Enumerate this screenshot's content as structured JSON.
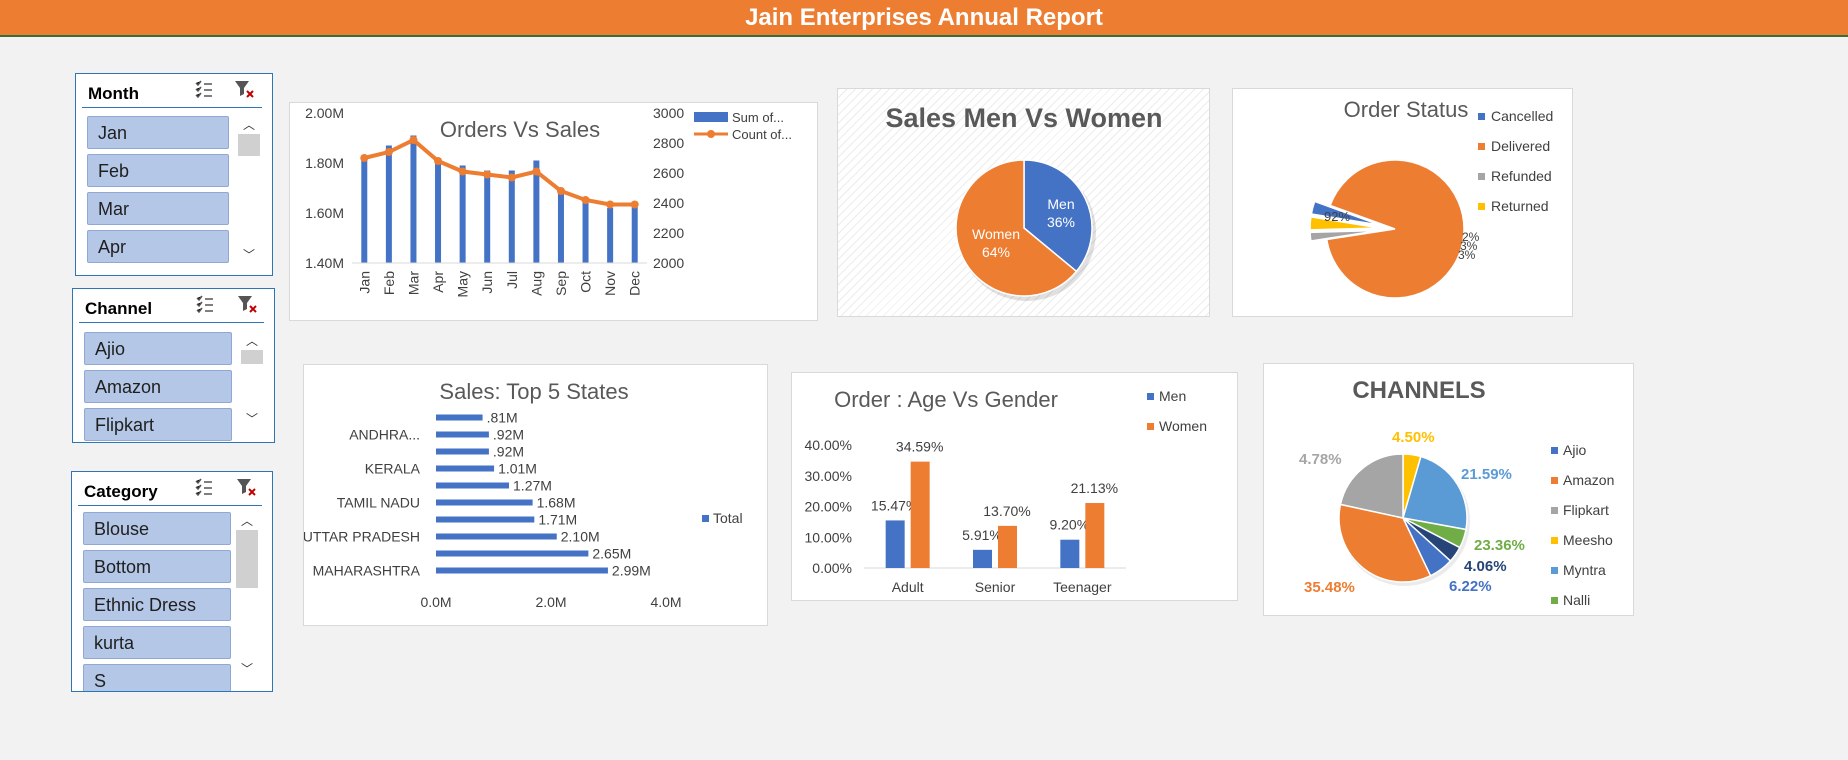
{
  "report_title": "Jain Enterprises Annual Report",
  "colors": {
    "blue": "#4472c4",
    "orange": "#ed7d31",
    "gray": "#a5a5a5",
    "yellow": "#ffc000",
    "lightblue": "#5b9bd5",
    "green": "#70ad47",
    "darkblue": "#264478",
    "slicer_item": "#b4c7e7",
    "header": "#ed7d31"
  },
  "slicers": {
    "month": {
      "title": "Month",
      "items": [
        "Jan",
        "Feb",
        "Mar",
        "Apr"
      ]
    },
    "channel": {
      "title": "Channel",
      "items": [
        "Ajio",
        "Amazon",
        "Flipkart"
      ]
    },
    "category": {
      "title": "Category",
      "items": [
        "Blouse",
        "Bottom",
        "Ethnic Dress",
        "kurta",
        "S"
      ]
    },
    "icons": [
      "multi-select-icon",
      "clear-filter-icon",
      "scroll-up-icon",
      "scroll-down-icon"
    ]
  },
  "chart_data": [
    {
      "id": "orders_vs_sales",
      "type": "bar",
      "title": "Orders Vs Sales",
      "categories": [
        "Jan",
        "Feb",
        "Mar",
        "Apr",
        "May",
        "Jun",
        "Jul",
        "Aug",
        "Sep",
        "Oct",
        "Nov",
        "Dec"
      ],
      "series": [
        {
          "name": "Sum of...",
          "type": "bar",
          "axis": "left",
          "values": [
            1.83,
            1.87,
            1.91,
            1.82,
            1.79,
            1.77,
            1.77,
            1.81,
            1.7,
            1.65,
            1.62,
            1.63
          ]
        },
        {
          "name": "Count of...",
          "type": "line",
          "axis": "right",
          "values": [
            2700,
            2740,
            2820,
            2680,
            2610,
            2590,
            2570,
            2610,
            2480,
            2420,
            2390,
            2390
          ]
        }
      ],
      "left_ticks": [
        "2.00M",
        "1.80M",
        "1.60M",
        "1.40M"
      ],
      "right_ticks": [
        "3000",
        "2800",
        "2600",
        "2400",
        "2200",
        "2000"
      ],
      "ylim_left": [
        1.4,
        2.0
      ],
      "ylim_right": [
        2000,
        3000
      ],
      "legend": "top-right"
    },
    {
      "id": "sales_men_women",
      "type": "pie",
      "title": "Sales Men Vs Women",
      "labels": [
        "Men",
        "Women"
      ],
      "values": [
        36,
        64
      ],
      "value_labels": [
        "36%",
        "64%"
      ]
    },
    {
      "id": "order_status",
      "type": "pie",
      "title": "Order Status",
      "labels": [
        "Cancelled",
        "Delivered",
        "Refunded",
        "Returned"
      ],
      "values": [
        3,
        92,
        2,
        3
      ],
      "value_labels": [
        "3%",
        "92%",
        "2%",
        "3%"
      ],
      "legend": "right"
    },
    {
      "id": "top5_states",
      "type": "bar",
      "orientation": "horizontal",
      "title": "Sales: Top 5 States",
      "categories": [
        "MAHARASHTRA",
        "",
        "UTTAR PRADESH",
        "",
        "TAMIL NADU",
        "",
        "KERALA",
        "",
        "ANDHRA...",
        ""
      ],
      "series": [
        {
          "name": "Total",
          "values": [
            2.99,
            2.65,
            2.1,
            1.71,
            1.68,
            1.27,
            1.01,
            0.92,
            0.92,
            0.81
          ]
        }
      ],
      "value_labels": [
        "2.99M",
        "2.65M",
        "2.10M",
        "1.71M",
        "1.68M",
        "1.27M",
        "1.01M",
        ".92M",
        ".92M",
        ".81M"
      ],
      "x_ticks": [
        "0.0M",
        "2.0M",
        "4.0M"
      ],
      "xlim": [
        0,
        4.0
      ],
      "legend": "right"
    },
    {
      "id": "age_vs_gender",
      "type": "bar",
      "title": "Order : Age Vs Gender",
      "categories": [
        "Adult",
        "Senior",
        "Teenager"
      ],
      "series": [
        {
          "name": "Men",
          "values": [
            15.47,
            5.91,
            9.2
          ],
          "value_labels": [
            "15.47%",
            "5.91%",
            "9.20%"
          ]
        },
        {
          "name": "Women",
          "values": [
            34.59,
            13.7,
            21.13
          ],
          "value_labels": [
            "34.59%",
            "13.70%",
            "21.13%"
          ]
        }
      ],
      "y_ticks": [
        "40.00%",
        "30.00%",
        "20.00%",
        "10.00%",
        "0.00%"
      ],
      "ylim": [
        0,
        40
      ],
      "legend": "top-right"
    },
    {
      "id": "channels",
      "type": "pie",
      "title": "CHANNELS",
      "labels": [
        "Ajio",
        "Amazon",
        "Flipkart",
        "Meesho",
        "Myntra",
        "Nalli"
      ],
      "values": [
        6.22,
        35.48,
        21.59,
        4.5,
        23.36,
        4.78,
        4.06
      ],
      "value_labels": [
        "6.22%",
        "35.48%",
        "21.59%",
        "4.50%",
        "23.36%",
        "4.78%",
        "4.06%"
      ],
      "legend": "right"
    }
  ]
}
